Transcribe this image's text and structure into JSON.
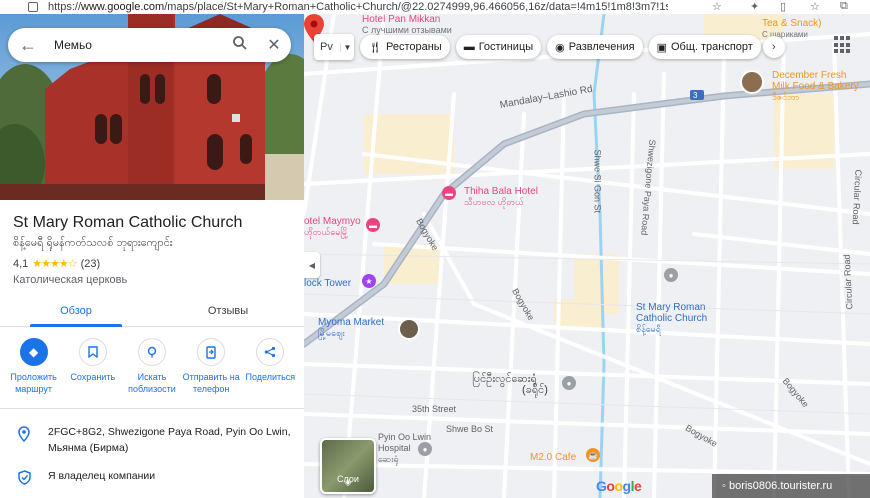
{
  "browser": {
    "url_prefix": "https://",
    "url_host": "www.google.com",
    "url_rest": "/maps/place/St+Mary+Roman+Catholic+Church/@22.0274999,96.466056,16z/data=!4m15!1m8!3m7!1s..."
  },
  "search": {
    "query": "Мемьо"
  },
  "place": {
    "title": "St Mary Roman Catholic Church",
    "local_name": "စိန့်မေရီ ရိုမန်ကတ်သလစ် ဘုရားကျောင်း",
    "rating": "4,1",
    "rating_value": 4.1,
    "stars": "★★★★☆",
    "review_count": "(23)",
    "category": "Католическая церковь"
  },
  "tabs": [
    {
      "label": "Обзор",
      "active": true
    },
    {
      "label": "Отзывы",
      "active": false
    }
  ],
  "actions": [
    {
      "label": "Проложить маршрут",
      "icon": "directions-icon"
    },
    {
      "label": "Сохранить",
      "icon": "bookmark-icon"
    },
    {
      "label": "Искать поблизости",
      "icon": "nearby-icon"
    },
    {
      "label": "Отправить на телефон",
      "icon": "send-to-phone-icon"
    },
    {
      "label": "Поделиться",
      "icon": "share-icon"
    }
  ],
  "info": {
    "address": "2FGC+8G2, Shwezigone Paya Road, Pyin Oo Lwin, Мьянма (Бирма)",
    "owner_claim": "Я владелец компании"
  },
  "map": {
    "mode_label": "Рv",
    "filters": [
      "Рестораны",
      "Гостиницы",
      "Развлечения",
      "Общ. транспорт"
    ],
    "layers_label": "Слои",
    "labels": {
      "hotel_top": "Hotel Pan Mikkan",
      "hotel_top_sub": "С лучшими отзывами",
      "tea": "Tea & Snack)",
      "tea_sub": "С шариками",
      "december": "December Fresh",
      "december2": "Milk Food & Bakery",
      "december_sub": "ဒီဇင်ဘာ",
      "road_mandalay": "Mandalay–Lashio Rd",
      "road_shwe_gon": "Shwe Si Gon St",
      "road_shwezigone": "Shwezigone Paya Road",
      "road_circular": "Circular Road",
      "road_circular2": "Circular Road",
      "road_bogyoke1": "Bogyoke",
      "road_bogyoke2": "Bogyoke",
      "road_bogyoke3": "Bogyoke",
      "road_bogyoke4": "Bogyoke",
      "thiha": "Thiha Bala Hotel",
      "thiha_sub": "သီဟဗလ ဟိုတယ်",
      "maymyo": "otel Maymyo",
      "maymyo_sub": "ဟိုတယ်မေမြို့",
      "clock": "lock Tower",
      "myoma": "Myoma Market",
      "myoma_sub": "မြို့မဈေး",
      "church": "St Mary Roman",
      "church2": "Catholic Church",
      "church_sub": "စိန့်မေရီ",
      "burmese_center": "ပြင်ဦးလွင်ဆေးရုံ",
      "burmese_center2": "(ခရိုင်)",
      "street_35th": "35th Street",
      "street_shwe_bo": "Shwe Bo St",
      "pyin_hospital": "Pyin Oo Lwin",
      "pyin_hospital2": "Hospital",
      "pyin_hospital_sub": "ဆေးရုံ",
      "cafe": "M2.0 Cafe",
      "road_3": "3"
    },
    "colors": {
      "primary_road": "#aab4c3",
      "secondary_road": "#ffffff",
      "blocks": "#faeed0",
      "water": "#9cd3f0",
      "pin_red": "#ea4335",
      "hotel_pink": "#e94583",
      "cafe_orange": "#f29423",
      "park_gray": "#9aa0a6",
      "accent_blue": "#1a73e8"
    }
  },
  "watermark": "◦ boris0806.tourister.ru",
  "google_logo": "Google"
}
